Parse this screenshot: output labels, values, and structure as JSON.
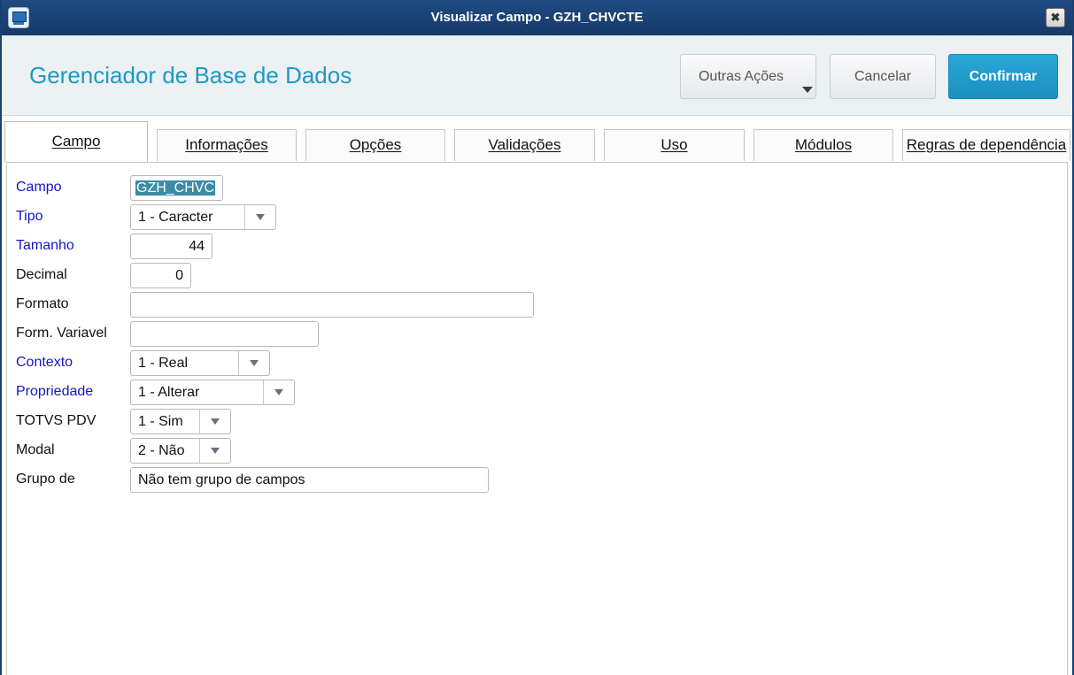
{
  "window": {
    "title": "Visualizar Campo - GZH_CHVCTE",
    "close_symbol": "✖",
    "app_icon": "monitor-icon"
  },
  "header": {
    "title": "Gerenciador de Base de Dados",
    "buttons": {
      "outras_acoes": "Outras Ações",
      "cancelar": "Cancelar",
      "confirmar": "Confirmar"
    }
  },
  "tabs": [
    {
      "label": "Campo",
      "active": true
    },
    {
      "label": "Informações",
      "active": false
    },
    {
      "label": "Opções",
      "active": false
    },
    {
      "label": "Validações",
      "active": false
    },
    {
      "label": "Uso",
      "active": false
    },
    {
      "label": "Módulos",
      "active": false
    },
    {
      "label": "Regras de dependência",
      "active": false
    }
  ],
  "form": {
    "campo": {
      "label": "Campo",
      "value": "GZH_CHVC"
    },
    "tipo": {
      "label": "Tipo",
      "value": "1 - Caracter"
    },
    "tamanho": {
      "label": "Tamanho",
      "value": "44"
    },
    "decimal": {
      "label": "Decimal",
      "value": "0"
    },
    "formato": {
      "label": "Formato",
      "value": ""
    },
    "form_variavel": {
      "label": "Form. Variavel",
      "value": ""
    },
    "contexto": {
      "label": "Contexto",
      "value": "1 - Real"
    },
    "propriedade": {
      "label": "Propriedade",
      "value": "1 - Alterar"
    },
    "totvs_pdv": {
      "label": "TOTVS PDV",
      "value": "1 - Sim"
    },
    "modal": {
      "label": "Modal",
      "value": "2 - Não"
    },
    "grupo": {
      "label": "Grupo de",
      "value": "Não tem grupo de campos"
    }
  },
  "colors": {
    "title_bar": "#1f4a82",
    "accent": "#1d9ac4",
    "confirm_button": "#2aa7d6",
    "required_label": "#1515c8",
    "selection": "#3b8ba6"
  }
}
